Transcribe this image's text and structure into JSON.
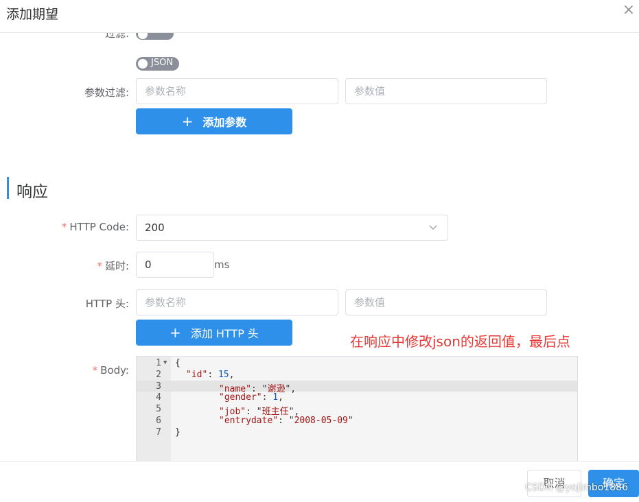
{
  "dialog": {
    "title": "添加期望",
    "close_symbol": "×"
  },
  "request": {
    "filter_label_partial": "过滤:",
    "json_toggle_label": "JSON",
    "param_filter_label": "参数过滤:",
    "param_name_placeholder": "参数名称",
    "param_value_placeholder": "参数值",
    "add_param_label": "添加参数",
    "plus_symbol": "+"
  },
  "response": {
    "section_title": "响应",
    "http_code_label": "HTTP Code:",
    "http_code_value": "200",
    "delay_label": "延时:",
    "delay_value": "0",
    "delay_unit": "ms",
    "http_header_label": "HTTP 头:",
    "header_name_placeholder": "参数名称",
    "header_value_placeholder": "参数值",
    "add_header_label": "添加 HTTP 头",
    "body_label": "Body:",
    "required_mark": "*",
    "body_json": {
      "id": "15",
      "name": "谢逊",
      "gender": "1",
      "job": "班主任",
      "entrydate": "2008-05-09"
    },
    "line_numbers": [
      "1",
      "2",
      "3",
      "4",
      "5",
      "6",
      "7"
    ]
  },
  "annotation": "在响应中修改json的返回值，最后点击确定",
  "footer": {
    "cancel_label": "取消",
    "confirm_label": "确定"
  },
  "watermark": "CSDN @yojimbo1886",
  "colors": {
    "primary": "#2e90e8",
    "required": "#f56c6c",
    "annotation": "#e53935"
  }
}
